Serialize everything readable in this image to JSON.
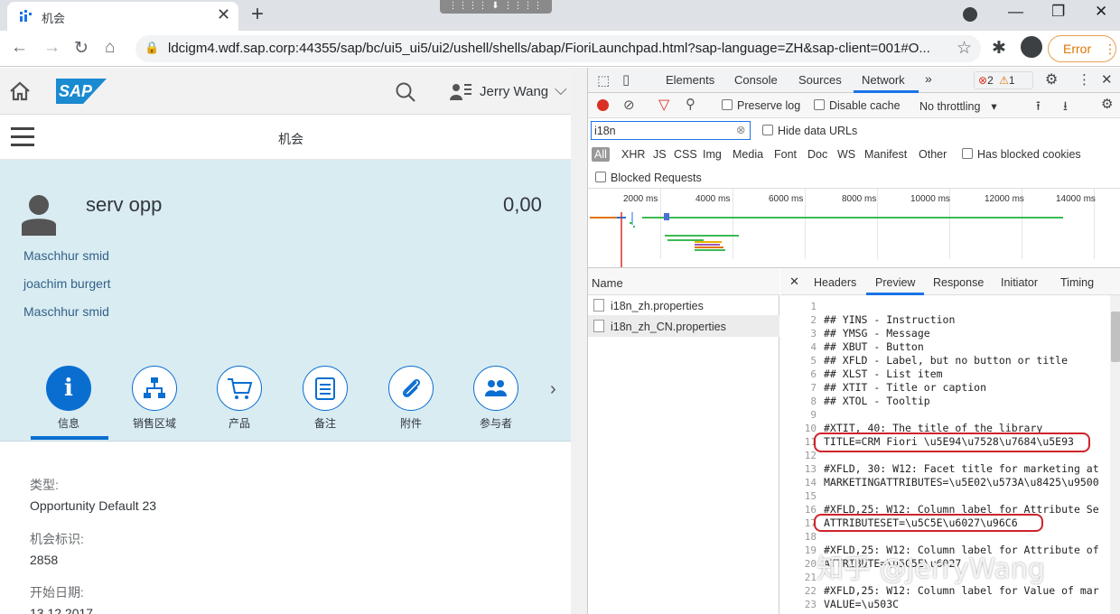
{
  "browser": {
    "tab_title": "机会",
    "url": "ldcigm4.wdf.sap.corp:44355/sap/bc/ui5_ui5/ui2/ushell/shells/abap/FioriLaunchpad.html?sap-language=ZH&sap-client=001#O...",
    "error_label": "Error"
  },
  "shell": {
    "logo": "SAP",
    "user": "Jerry Wang"
  },
  "page": {
    "title": "机会",
    "object_title": "serv opp",
    "amount": "0,00",
    "contacts": [
      "Maschhur smid",
      "joachim burgert",
      "Maschhur smid"
    ],
    "sections": [
      {
        "label": "信息",
        "icon": "info-icon"
      },
      {
        "label": "销售区域",
        "icon": "org-chart-icon"
      },
      {
        "label": "产品",
        "icon": "cart-icon"
      },
      {
        "label": "备注",
        "icon": "notes-icon"
      },
      {
        "label": "附件",
        "icon": "paperclip-icon"
      },
      {
        "label": "参与者",
        "icon": "people-icon"
      }
    ],
    "fields": [
      {
        "label": "类型:",
        "value": "Opportunity Default 23"
      },
      {
        "label": "机会标识:",
        "value": "2858"
      },
      {
        "label": "开始日期:",
        "value": "13.12.2017"
      }
    ]
  },
  "devtools": {
    "tabs": [
      "Elements",
      "Console",
      "Sources",
      "Network"
    ],
    "active_tab": "Network",
    "error_count": "2",
    "warning_count": "1",
    "preserve_log": "Preserve log",
    "disable_cache": "Disable cache",
    "throttling": "No throttling",
    "filter_value": "i18n",
    "hide_data_urls": "Hide data URLs",
    "type_filters": [
      "All",
      "XHR",
      "JS",
      "CSS",
      "Img",
      "Media",
      "Font",
      "Doc",
      "WS",
      "Manifest",
      "Other"
    ],
    "has_blocked_cookies": "Has blocked cookies",
    "blocked_requests": "Blocked Requests",
    "timeline_ticks": [
      "2000 ms",
      "4000 ms",
      "6000 ms",
      "8000 ms",
      "10000 ms",
      "12000 ms",
      "14000 ms"
    ],
    "name_header": "Name",
    "requests": [
      "i18n_zh.properties",
      "i18n_zh_CN.properties"
    ],
    "detail_tabs": [
      "Headers",
      "Preview",
      "Response",
      "Initiator",
      "Timing"
    ],
    "active_detail_tab": "Preview",
    "preview_lines": [
      {
        "n": "1",
        "t": ""
      },
      {
        "n": "2",
        "t": "## YINS - Instruction"
      },
      {
        "n": "3",
        "t": "## YMSG - Message"
      },
      {
        "n": "4",
        "t": "## XBUT - Button"
      },
      {
        "n": "5",
        "t": "## XFLD - Label, but no button or title"
      },
      {
        "n": "6",
        "t": "## XLST - List item"
      },
      {
        "n": "7",
        "t": "## XTIT - Title or caption"
      },
      {
        "n": "8",
        "t": "## XTOL - Tooltip"
      },
      {
        "n": "9",
        "t": ""
      },
      {
        "n": "10",
        "t": "#XTIT, 40: The title of the library"
      },
      {
        "n": "11",
        "t": "TITLE=CRM Fiori \\u5E94\\u7528\\u7684\\u5E93"
      },
      {
        "n": "12",
        "t": ""
      },
      {
        "n": "13",
        "t": "#XFLD, 30: W12: Facet title for marketing at"
      },
      {
        "n": "14",
        "t": "MARKETINGATTRIBUTES=\\u5E02\\u573A\\u8425\\u9500"
      },
      {
        "n": "15",
        "t": ""
      },
      {
        "n": "16",
        "t": "#XFLD,25: W12: Column label for Attribute Se"
      },
      {
        "n": "17",
        "t": "ATTRIBUTESET=\\u5C5E\\u6027\\u96C6"
      },
      {
        "n": "18",
        "t": ""
      },
      {
        "n": "19",
        "t": "#XFLD,25: W12: Column label for Attribute of"
      },
      {
        "n": "20",
        "t": "ATTRIBUTE=\\u5C5E\\u6027"
      },
      {
        "n": "21",
        "t": ""
      },
      {
        "n": "22",
        "t": "#XFLD,25: W12: Column label for Value of mar"
      },
      {
        "n": "23",
        "t": "VALUE=\\u503C"
      }
    ]
  },
  "watermark": "知乎 @JerryWang",
  "colors": {
    "sap_blue": "#0a6ed1",
    "header_bg": "#d8ecf2",
    "devtools_accent": "#1a73e8",
    "highlight": "#d0232a"
  }
}
